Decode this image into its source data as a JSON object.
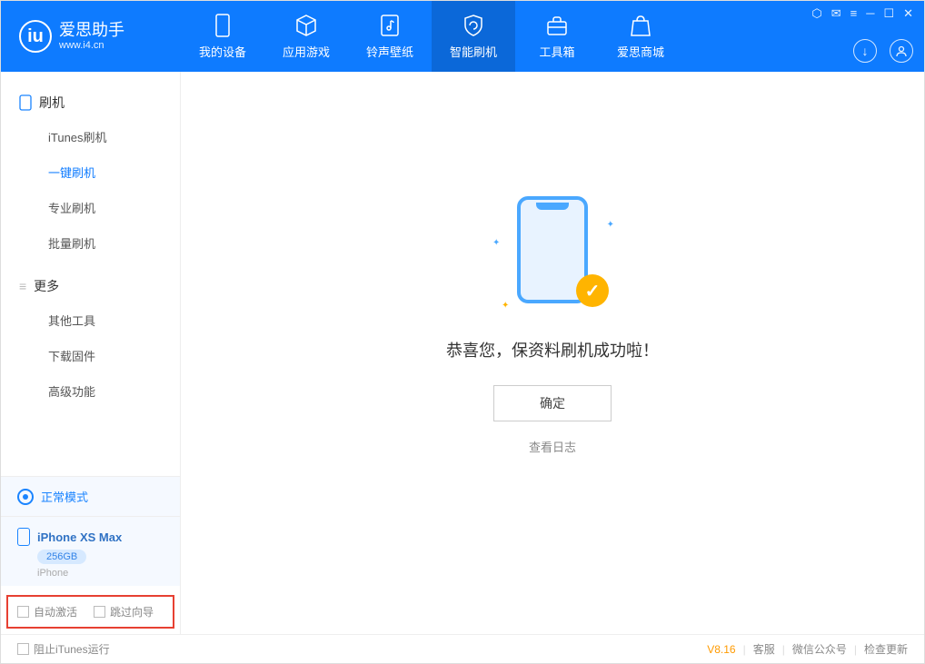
{
  "header": {
    "app_name": "爱思助手",
    "app_url": "www.i4.cn",
    "tabs": [
      {
        "label": "我的设备"
      },
      {
        "label": "应用游戏"
      },
      {
        "label": "铃声壁纸"
      },
      {
        "label": "智能刷机"
      },
      {
        "label": "工具箱"
      },
      {
        "label": "爱思商城"
      }
    ]
  },
  "sidebar": {
    "group1_title": "刷机",
    "group1_items": [
      "iTunes刷机",
      "一键刷机",
      "专业刷机",
      "批量刷机"
    ],
    "group2_title": "更多",
    "group2_items": [
      "其他工具",
      "下载固件",
      "高级功能"
    ],
    "mode_label": "正常模式",
    "device_name": "iPhone XS Max",
    "device_storage": "256GB",
    "device_type": "iPhone",
    "chk_auto_activate": "自动激活",
    "chk_skip_guide": "跳过向导"
  },
  "main": {
    "success_text": "恭喜您，保资料刷机成功啦！",
    "ok_button": "确定",
    "view_log": "查看日志"
  },
  "footer": {
    "block_itunes": "阻止iTunes运行",
    "version": "V8.16",
    "links": [
      "客服",
      "微信公众号",
      "检查更新"
    ]
  }
}
